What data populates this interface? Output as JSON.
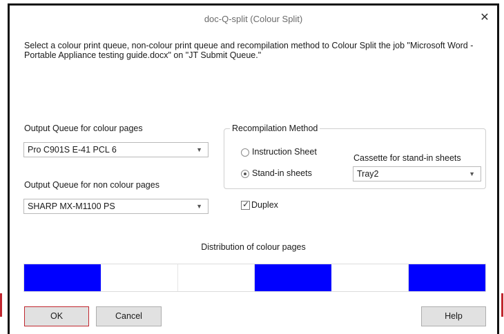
{
  "dialog": {
    "title": "doc-Q-split (Colour Split)",
    "close_glyph": "✕",
    "description": "Select a colour print queue, non-colour print queue and recompilation method to Colour Split the job \"Microsoft Word - Portable Appliance testing guide.docx\" on \"JT Submit Queue.\""
  },
  "colour_queue": {
    "label": "Output Queue for colour pages",
    "value": "Pro C901S E-41 PCL 6"
  },
  "noncolour_queue": {
    "label": "Output Queue for non colour pages",
    "value": "SHARP MX-M1100 PS"
  },
  "recompilation": {
    "title": "Recompilation Method",
    "options": [
      {
        "label": "Instruction Sheet",
        "selected": false
      },
      {
        "label": "Stand-in sheets",
        "selected": true
      }
    ],
    "cassette_label": "Cassette for stand-in sheets",
    "cassette_value": "Tray2"
  },
  "duplex": {
    "label": "Duplex",
    "checked": true
  },
  "distribution": {
    "label": "Distribution of colour pages",
    "pages": [
      true,
      false,
      false,
      true,
      false,
      true
    ],
    "colour_fill": "#0000ff"
  },
  "buttons": {
    "ok": "OK",
    "cancel": "Cancel",
    "help": "Help"
  },
  "colors": {
    "default_button_border": "#c0262e",
    "title_text": "#6a6a6a"
  }
}
